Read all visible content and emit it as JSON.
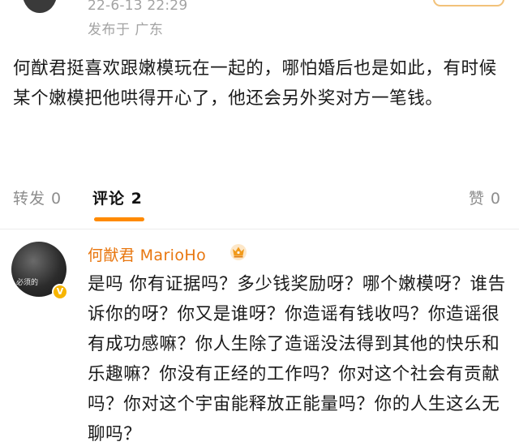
{
  "post": {
    "timestamp": "22-6-13 22:29",
    "location": "发布于 广东",
    "body": "何猷君挺喜欢跟嫩模玩在一起的，哪怕婚后也是如此，有时候某个嫩模把他哄得开心了，他还会另外奖对方一笔钱。"
  },
  "tabs": [
    {
      "label": "转发 0"
    },
    {
      "label": "评论 2"
    },
    {
      "label": "赞 0"
    }
  ],
  "comment": {
    "author": "何猷君 MarioHo",
    "avatar_caption": "必须的",
    "text": "是吗 你有证据吗？多少钱奖励呀？哪个嫩模呀？谁告诉你的呀？你又是谁呀？你造谣有钱收吗？你造谣很有成功感嘛？你人生除了造谣没法得到其他的快乐和乐趣嘛？你没有正经的工作吗？你对这个社会有贡献吗？你对这个宇宙能释放正能量吗？你的人生这么无聊吗？"
  },
  "colors": {
    "accent": "#ff8a00",
    "username": "#e8760e",
    "meta": "#a3a3a3"
  },
  "icons": [
    "crown-icon",
    "verified-icon"
  ]
}
